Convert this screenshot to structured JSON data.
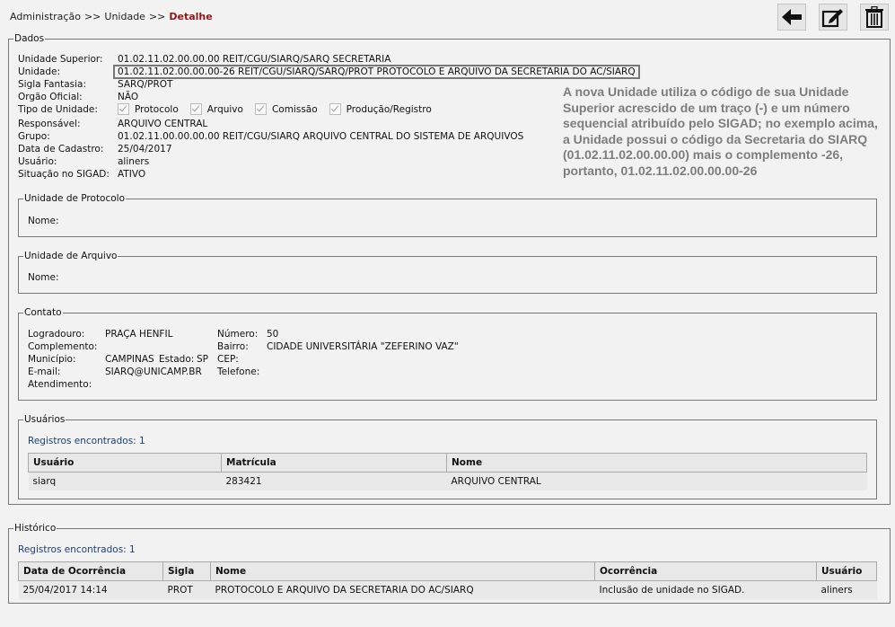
{
  "breadcrumb": {
    "items": [
      "Administração",
      "Unidade"
    ],
    "separator": ">>",
    "current": "Detalhe"
  },
  "toolbar": {
    "back_icon": "arrow-left-icon",
    "edit_icon": "edit-icon",
    "delete_icon": "trash-icon"
  },
  "dados": {
    "legend": "Dados",
    "fields": {
      "unidade_superior": {
        "label": "Unidade Superior:",
        "value": "01.02.11.02.00.00.00 REIT/CGU/SIARQ/SARQ SECRETARIA"
      },
      "unidade": {
        "label": "Unidade:",
        "value": "01.02.11.02.00.00.00-26 REIT/CGU/SIARQ/SARQ/PROT PROTOCOLO E ARQUIVO DA SECRETARIA DO AC/SIARQ"
      },
      "sigla": {
        "label": "Sigla Fantasia:",
        "value": "SARQ/PROT"
      },
      "orgao": {
        "label": "Orgão Oficial:",
        "value": "NÃO"
      },
      "tipo": {
        "label": "Tipo de Unidade:",
        "options": [
          "Protocolo",
          "Arquivo",
          "Comissão",
          "Produção/Registro"
        ]
      },
      "responsavel": {
        "label": "Responsável:",
        "value": "ARQUIVO CENTRAL"
      },
      "grupo": {
        "label": "Grupo:",
        "value": "01.02.11.00.00.00.00 REIT/CGU/SIARQ ARQUIVO CENTRAL DO SISTEMA DE ARQUIVOS"
      },
      "data_cadastro": {
        "label": "Data de Cadastro:",
        "value": "25/04/2017"
      },
      "usuario": {
        "label": "Usuário:",
        "value": "aliners"
      },
      "situacao": {
        "label": "Situação no SIGAD:",
        "value": "ATIVO"
      }
    },
    "note": "A nova Unidade utiliza o código de sua Unidade Superior acrescido de um traço (-) e um número sequencial atribuído pelo SIGAD; no exemplo acima, a Unidade possui o código da Secretaria do SIARQ (01.02.11.02.00.00.00) mais o complemento -26, portanto, 01.02.11.02.00.00.00-26"
  },
  "unidade_protocolo": {
    "legend": "Unidade de Protocolo",
    "nome_label": "Nome:"
  },
  "unidade_arquivo": {
    "legend": "Unidade de Arquivo",
    "nome_label": "Nome:"
  },
  "contato": {
    "legend": "Contato",
    "logradouro": {
      "label": "Logradouro:",
      "value": "PRAÇA HENFIL"
    },
    "numero": {
      "label": "Número:",
      "value": "50"
    },
    "complemento": {
      "label": "Complemento:",
      "value": ""
    },
    "bairro": {
      "label": "Bairro:",
      "value": "CIDADE UNIVERSITÁRIA \"ZEFERINO VAZ\""
    },
    "municipio": {
      "label": "Município:",
      "value": "CAMPINAS"
    },
    "estado": {
      "label": "Estado:",
      "value": "SP"
    },
    "cep": {
      "label": "CEP:",
      "value": ""
    },
    "email": {
      "label": "E-mail:",
      "value": "SIARQ@UNICAMP.BR"
    },
    "telefone": {
      "label": "Telefone:",
      "value": ""
    },
    "atendimento": {
      "label": "Atendimento:",
      "value": ""
    }
  },
  "usuarios": {
    "legend": "Usuários",
    "registros": "Registros encontrados: 1",
    "columns": [
      "Usuário",
      "Matrícula",
      "Nome"
    ],
    "rows": [
      [
        "siarq",
        "283421",
        "ARQUIVO CENTRAL"
      ]
    ]
  },
  "historico": {
    "legend": "Histórico",
    "registros": "Registros encontrados: 1",
    "columns": [
      "Data de Ocorrência",
      "Sigla",
      "Nome",
      "Ocorrência",
      "Usuário"
    ],
    "rows": [
      [
        "25/04/2017 14:14",
        "PROT",
        "PROTOCOLO E ARQUIVO DA SECRETARIA DO AC/SIARQ",
        "Inclusão de unidade no SIGAD.",
        "aliners"
      ]
    ]
  }
}
